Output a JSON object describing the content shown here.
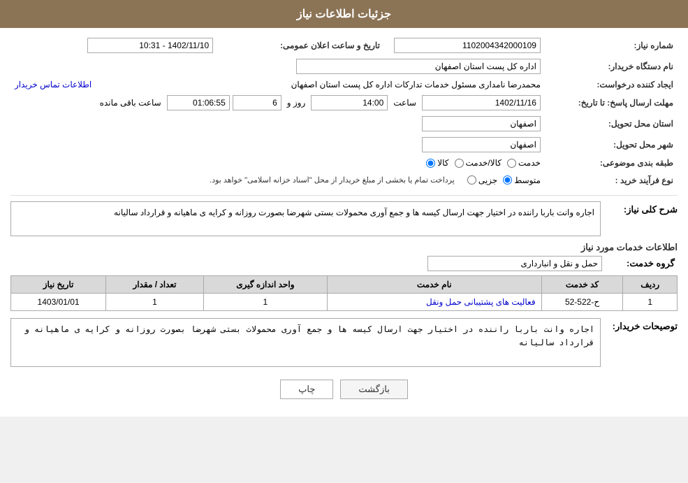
{
  "header": {
    "title": "جزئیات اطلاعات نیاز"
  },
  "fields": {
    "request_number_label": "شماره نیاز:",
    "request_number_value": "1102004342000109",
    "announce_date_label": "تاریخ و ساعت اعلان عمومی:",
    "announce_date_value": "1402/11/10 - 10:31",
    "buyer_org_label": "نام دستگاه خریدار:",
    "buyer_org_value": "اداره کل پست استان اصفهان",
    "creator_label": "ایجاد کننده درخواست:",
    "creator_value": "محمدرضا نامداری مسئول خدمات تدارکات اداره کل پست استان اصفهان",
    "creator_link": "اطلاعات تماس خریدار",
    "deadline_label": "مهلت ارسال پاسخ: تا تاریخ:",
    "deadline_date": "1402/11/16",
    "deadline_time_label": "ساعت",
    "deadline_time": "14:00",
    "deadline_days_label": "روز و",
    "deadline_days": "6",
    "deadline_remaining_label": "ساعت باقی مانده",
    "deadline_remaining": "01:06:55",
    "province_label": "استان محل تحویل:",
    "province_value": "اصفهان",
    "city_label": "شهر محل تحویل:",
    "city_value": "اصفهان",
    "category_label": "طبقه بندی موضوعی:",
    "category_options": [
      "کالا",
      "خدمت",
      "کالا/خدمت"
    ],
    "category_selected": "کالا",
    "procurement_label": "نوع فرآیند خرید :",
    "procurement_options": [
      "جزیی",
      "متوسط"
    ],
    "procurement_selected": "متوسط",
    "procurement_note": "پرداخت تمام یا بخشی از مبلغ خریدار از محل \"اسناد خزانه اسلامی\" خواهد بود.",
    "description_label": "شرح کلی نیاز:",
    "description_value": "اجاره وانت باربا راننده در اختیار جهت ارسال کیسه ها و جمع آوری محمولات بستی شهرضا بصورت روزانه و کرایه ی ماهیانه و قرارداد سالیانه",
    "services_section_label": "اطلاعات خدمات مورد نیاز",
    "service_group_label": "گروه خدمت:",
    "service_group_value": "حمل و نقل و انبارداری",
    "table_headers": [
      "ردیف",
      "کد خدمت",
      "نام خدمت",
      "واحد اندازه گیری",
      "تعداد / مقدار",
      "تاریخ نیاز"
    ],
    "table_rows": [
      {
        "row": "1",
        "code": "ح-522-52",
        "name": "فعالیت های پشتیبانی حمل ونقل",
        "unit": "1",
        "quantity": "1",
        "date": "1403/01/01"
      }
    ],
    "buyer_notes_label": "توصیحات خریدار:",
    "buyer_notes_value": "اجاره وانت باربا راننده در اختیار جهت ارسال کیسه ها و جمع آوری محمولات بستی شهرضا بصورت روزانه و کرایه ی ماهیانه و قرارداد سالیانه"
  },
  "buttons": {
    "print": "چاپ",
    "back": "بازگشت"
  }
}
